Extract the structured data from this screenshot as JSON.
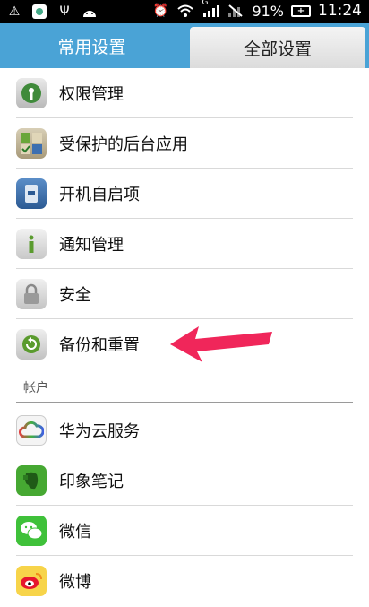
{
  "status_bar": {
    "battery": "91%",
    "time": "11:24",
    "signal_label": "G"
  },
  "tabs": {
    "common": "常用设置",
    "all": "全部设置"
  },
  "settings": [
    {
      "label": "权限管理",
      "icon": "permission-icon"
    },
    {
      "label": "受保护的后台应用",
      "icon": "protected-apps-icon"
    },
    {
      "label": "开机自启项",
      "icon": "startup-icon"
    },
    {
      "label": "通知管理",
      "icon": "info-icon"
    },
    {
      "label": "安全",
      "icon": "lock-icon"
    },
    {
      "label": "备份和重置",
      "icon": "backup-icon"
    }
  ],
  "accounts_section": "帐户",
  "accounts": [
    {
      "label": "华为云服务",
      "icon": "cloud-icon"
    },
    {
      "label": "印象笔记",
      "icon": "evernote-icon"
    },
    {
      "label": "微信",
      "icon": "wechat-icon"
    },
    {
      "label": "微博",
      "icon": "weibo-icon"
    }
  ],
  "colors": {
    "tab_active_bg": "#4aa3d6",
    "arrow": "#f0265a"
  }
}
